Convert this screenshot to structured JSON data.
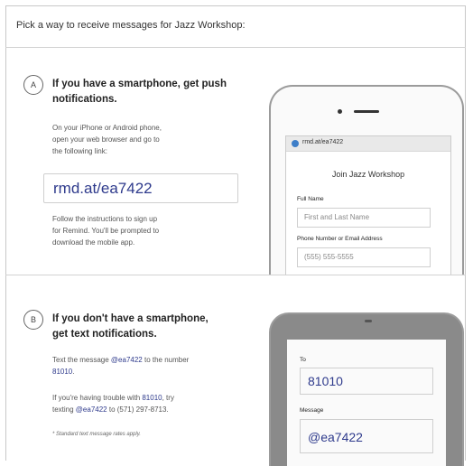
{
  "header": {
    "text": "Pick a way to receive messages for Jazz Workshop:"
  },
  "sectionA": {
    "badge": "A",
    "title_line1": "If you have a smartphone, get push",
    "title_line2": "notifications.",
    "instr_line1": "On your iPhone or Android phone,",
    "instr_line2": "open your web browser and go to",
    "instr_line3": "the following link:",
    "link": "rmd.at/ea7422",
    "follow_line1": "Follow the instructions to sign up",
    "follow_line2": "for Remind. You'll be prompted to",
    "follow_line3": "download the mobile app."
  },
  "phoneA": {
    "url": "rmd.at/ea7422",
    "join_title": "Join Jazz Workshop",
    "full_name_label": "Full Name",
    "full_name_placeholder": "First and Last Name",
    "contact_label": "Phone Number or Email Address",
    "contact_placeholder": "(555) 555-5555"
  },
  "sectionB": {
    "badge": "B",
    "title_line1": "If you don't have a smartphone,",
    "title_line2": "get text notifications.",
    "text_pre": "Text the message ",
    "text_code": "@ea7422",
    "text_mid": " to the number",
    "text_number": "81010",
    "text_end": ".",
    "trouble_pre": "If you're having trouble with ",
    "trouble_number": "81010",
    "trouble_mid": ", try",
    "trouble_pre2": "texting ",
    "trouble_code": "@ea7422",
    "trouble_end": " to (571) 297-8713.",
    "footnote": "* Standard text message rates apply."
  },
  "phoneB": {
    "to_label": "To",
    "to_value": "81010",
    "message_label": "Message",
    "message_value": "@ea7422"
  },
  "colors": {
    "accent": "#2e3a8c",
    "border": "#c8c8c8"
  }
}
